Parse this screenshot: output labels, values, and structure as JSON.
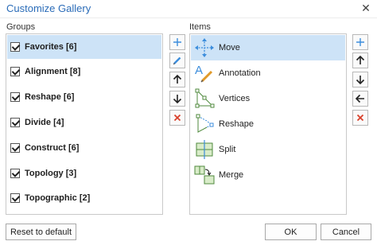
{
  "dialog": {
    "title": "Customize Gallery",
    "close_glyph": "✕"
  },
  "groups": {
    "label": "Groups",
    "items": [
      {
        "label": "Favorites [6]",
        "checked": true,
        "selected": true
      },
      {
        "label": "Alignment [8]",
        "checked": true
      },
      {
        "label": "Reshape [6]",
        "checked": true
      },
      {
        "label": "Divide [4]",
        "checked": true
      },
      {
        "label": "Construct [6]",
        "checked": true
      },
      {
        "label": "Topology [3]",
        "checked": true
      },
      {
        "label": "Topographic [2]",
        "checked": true
      }
    ]
  },
  "items": {
    "label": "Items",
    "items": [
      {
        "label": "Move",
        "icon": "move-icon",
        "selected": true
      },
      {
        "label": "Annotation",
        "icon": "annotation-icon"
      },
      {
        "label": "Vertices",
        "icon": "vertices-icon"
      },
      {
        "label": "Reshape",
        "icon": "reshape-icon"
      },
      {
        "label": "Split",
        "icon": "split-icon"
      },
      {
        "label": "Merge",
        "icon": "merge-icon"
      }
    ]
  },
  "group_tools": [
    "add-icon",
    "edit-icon",
    "move-up-icon",
    "move-down-icon",
    "delete-icon"
  ],
  "item_tools": [
    "add-icon",
    "move-up-icon",
    "move-down-icon",
    "remove-from-group-icon",
    "delete-icon"
  ],
  "buttons": {
    "reset": "Reset to default",
    "ok": "OK",
    "cancel": "Cancel"
  },
  "colors": {
    "title": "#2b6cb8",
    "selection": "#cde3f7",
    "delete": "#d9402b",
    "icon_blue": "#3c8ddc",
    "icon_green": "#4f8a3d"
  }
}
